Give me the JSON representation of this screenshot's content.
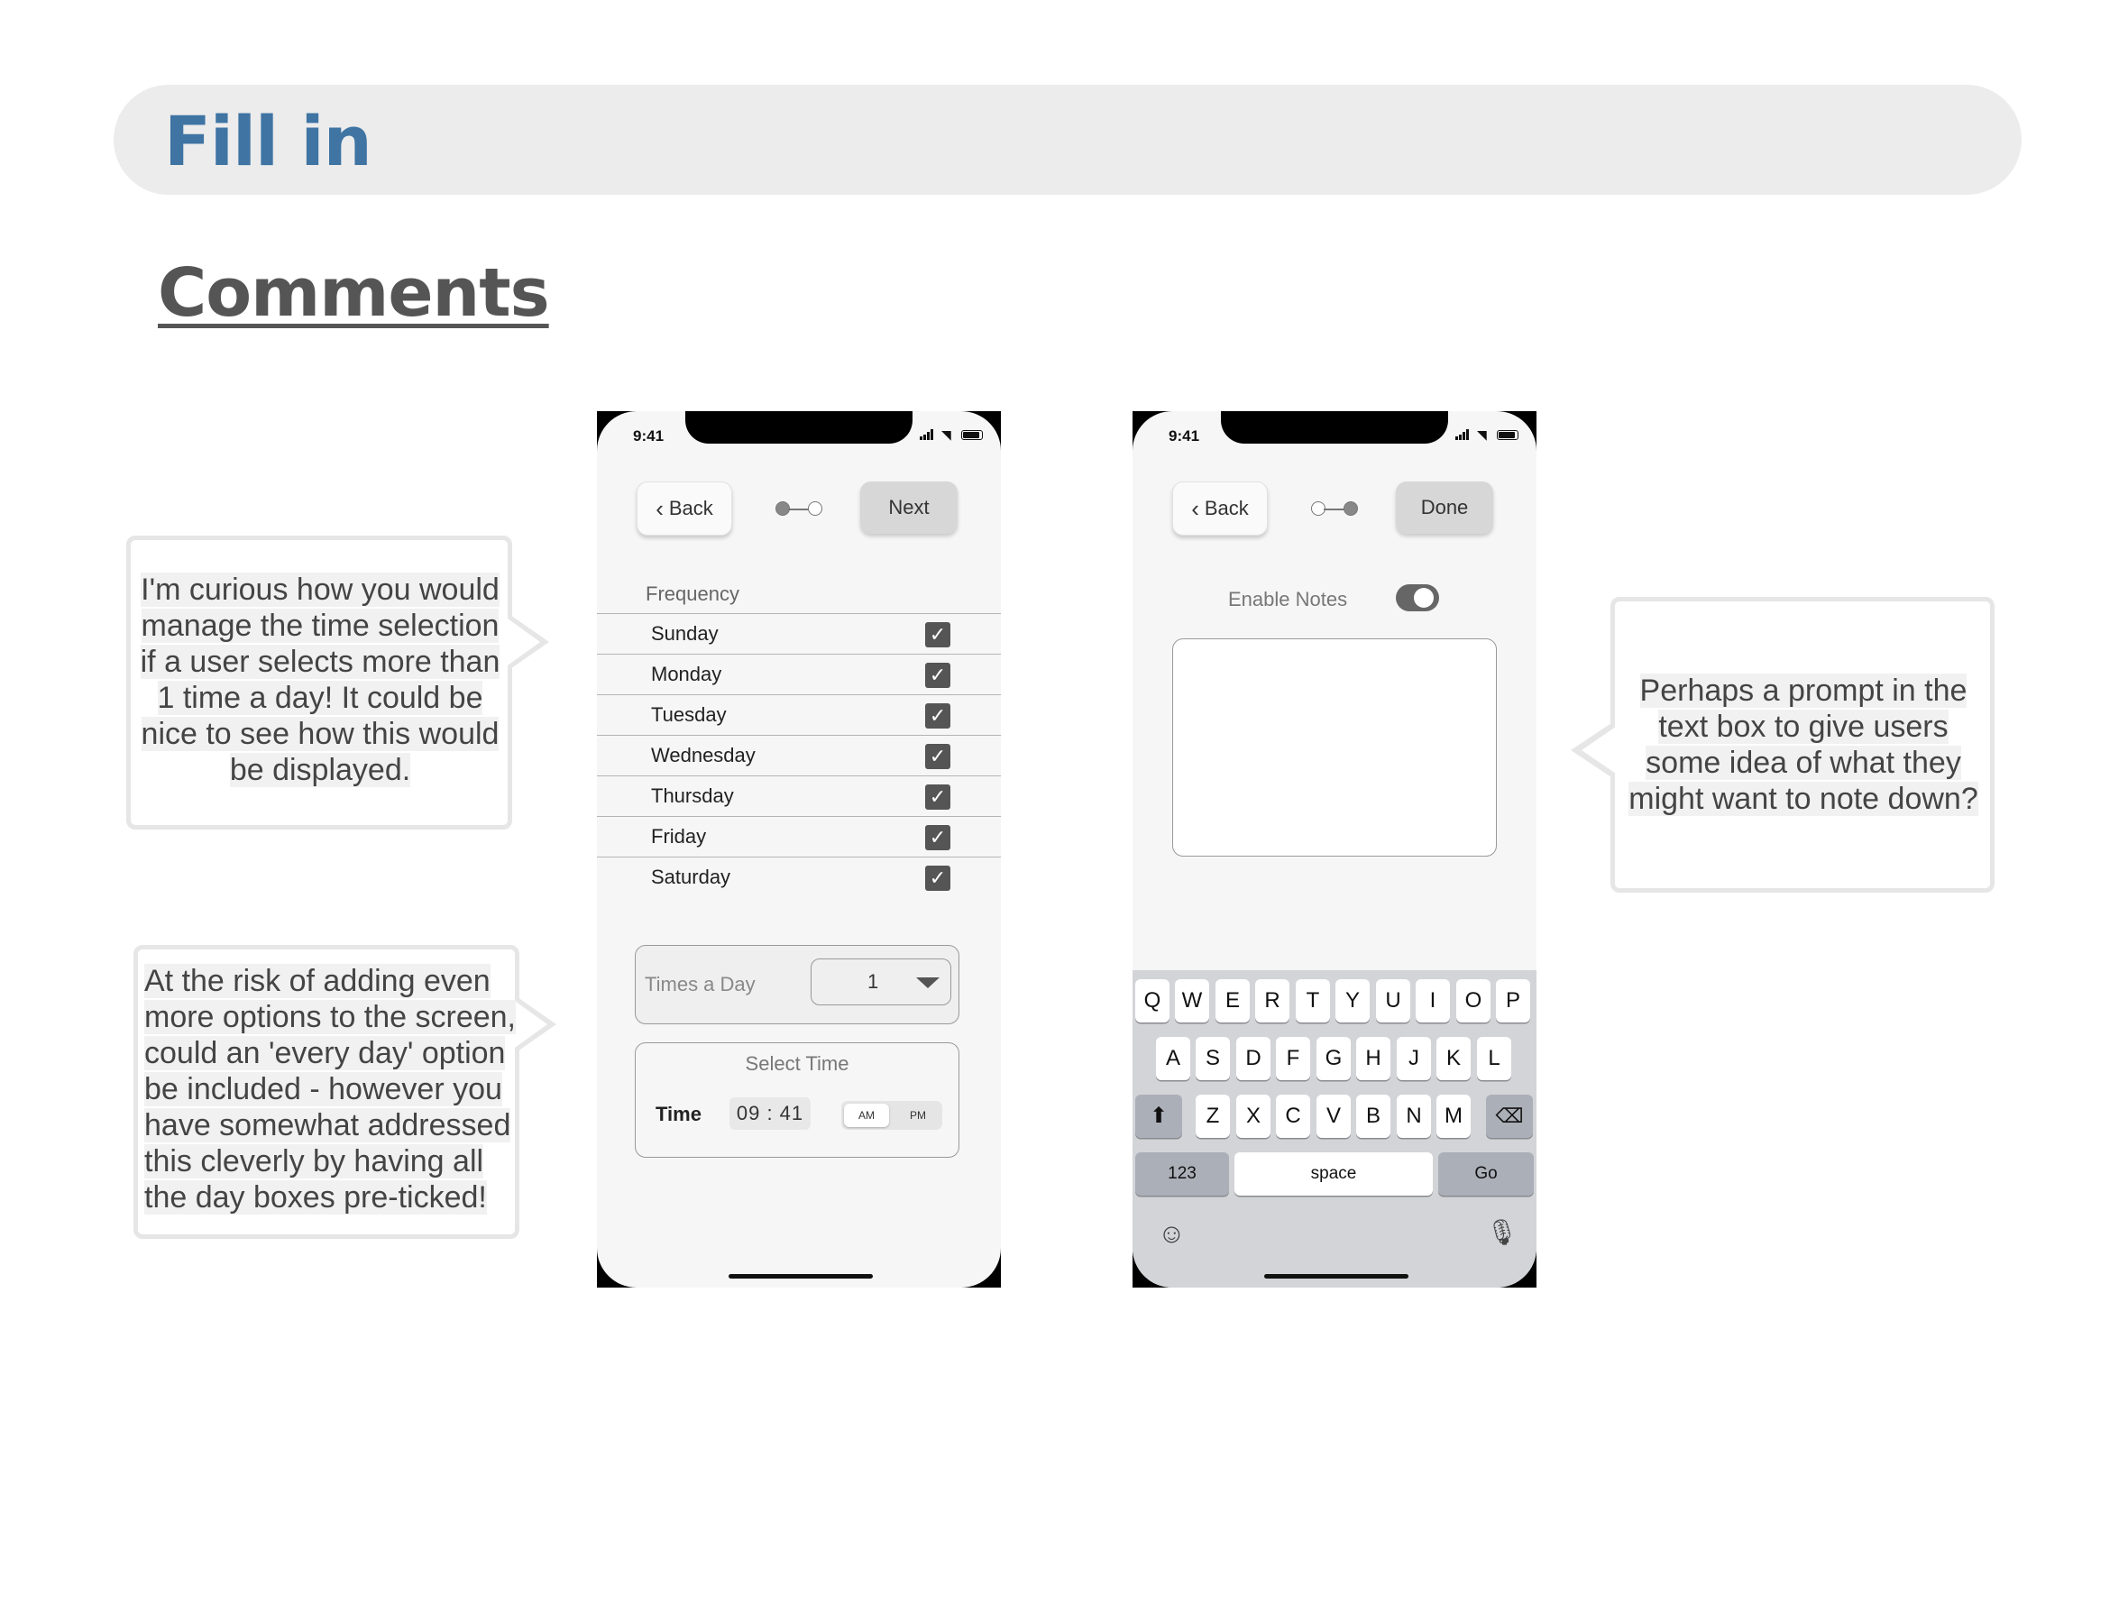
{
  "header": {
    "title": "Fill in"
  },
  "section": {
    "title": "Comments"
  },
  "callouts": {
    "c1": [
      "I'm curious how you would",
      "manage the time selection",
      "if a user selects more than",
      "1 time a day! It could be",
      "nice to see how this would",
      "be displayed."
    ],
    "c2": [
      "At the risk of adding even",
      "more options to the screen,",
      "could an 'every day' option",
      "be included - however you",
      "have somewhat addressed",
      "this cleverly by having all",
      "the day boxes pre-ticked!"
    ],
    "c3": [
      "Perhaps a prompt in the",
      "text box to give users",
      "some idea of what they",
      "might want to note down?"
    ]
  },
  "phone1": {
    "status_time": "9:41",
    "back": "Back",
    "next": "Next",
    "frequency_label": "Frequency",
    "days": [
      "Sunday",
      "Monday",
      "Tuesday",
      "Wednesday",
      "Thursday",
      "Friday",
      "Saturday"
    ],
    "check_glyph": "✓",
    "times_label": "Times a Day",
    "times_value": "1",
    "select_time": "Select Time",
    "time_label": "Time",
    "time_value": "09 : 41",
    "am": "AM",
    "pm": "PM"
  },
  "phone2": {
    "status_time": "9:41",
    "back": "Back",
    "done": "Done",
    "enable_notes": "Enable Notes",
    "notes_enabled": true,
    "keyboard": {
      "row1": [
        "Q",
        "W",
        "E",
        "R",
        "T",
        "Y",
        "U",
        "I",
        "O",
        "P"
      ],
      "row2": [
        "A",
        "S",
        "D",
        "F",
        "G",
        "H",
        "J",
        "K",
        "L"
      ],
      "row3": [
        "Z",
        "X",
        "C",
        "V",
        "B",
        "N",
        "M"
      ],
      "numbers": "123",
      "space": "space",
      "go": "Go"
    }
  }
}
